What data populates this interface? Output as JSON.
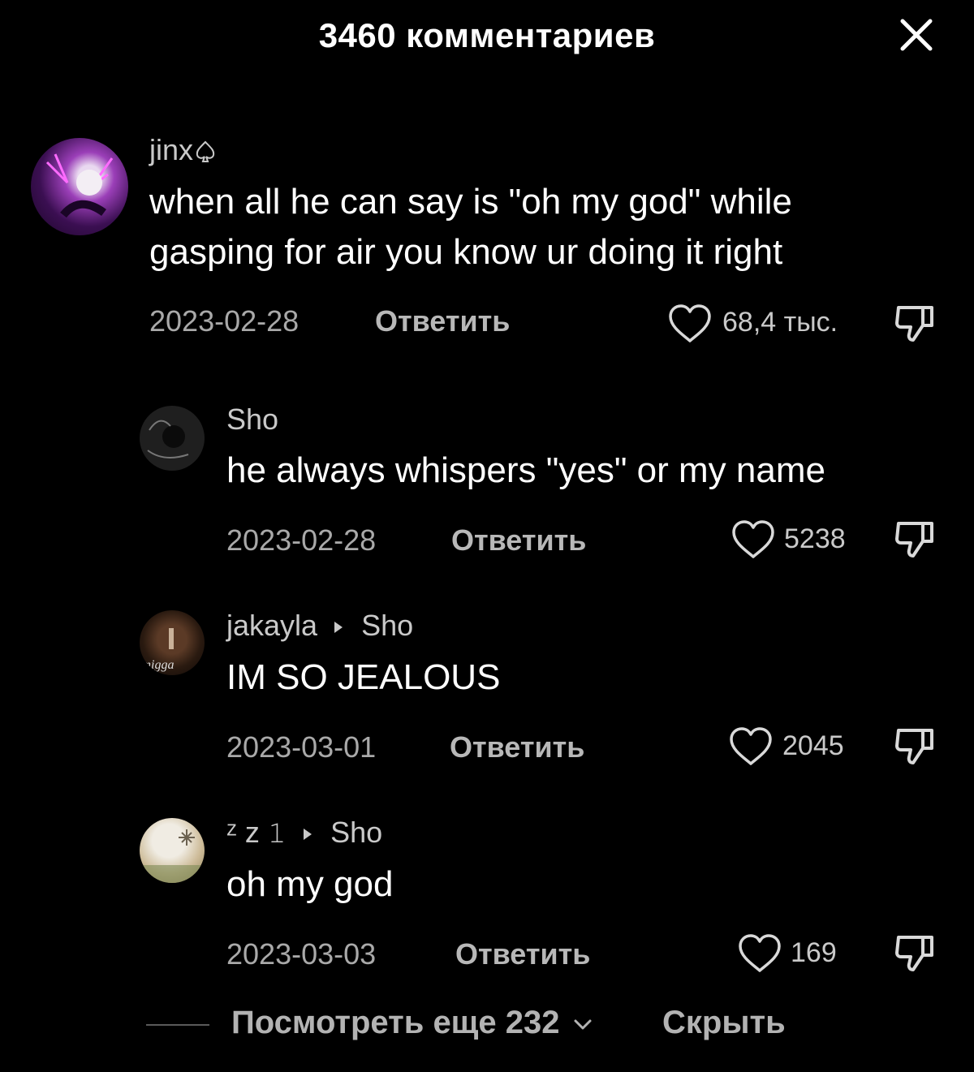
{
  "header": {
    "title": "3460 комментариев"
  },
  "comments": [
    {
      "username": "jinx",
      "text": "when all he can say is \"oh my god\" while gasping for air you know ur doing it right",
      "date": "2023-02-28",
      "reply_label": "Ответить",
      "likes": "68,4 тыс."
    }
  ],
  "replies": [
    {
      "username": "Sho",
      "text": "he always whispers \"yes\" or my name",
      "date": "2023-02-28",
      "reply_label": "Ответить",
      "likes": "5238"
    },
    {
      "username": "jakayla",
      "reply_to": "Sho",
      "avatar_text": "nigga",
      "text": "IM SO JEALOUS",
      "date": "2023-03-01",
      "reply_label": "Ответить",
      "likes": "2045"
    },
    {
      "username": "ᶻ z 𝟷",
      "reply_to": "Sho",
      "text": "oh my god",
      "date": "2023-03-03",
      "reply_label": "Ответить",
      "likes": "169"
    }
  ],
  "footer": {
    "view_more": "Посмотреть еще 232",
    "hide": "Скрыть"
  },
  "icons": {
    "close": "close-icon",
    "heart": "heart-icon",
    "dislike": "dislike-icon",
    "spade": "spade-icon",
    "reply_arrow": "triangle-right-icon",
    "chevron": "chevron-down-icon"
  }
}
